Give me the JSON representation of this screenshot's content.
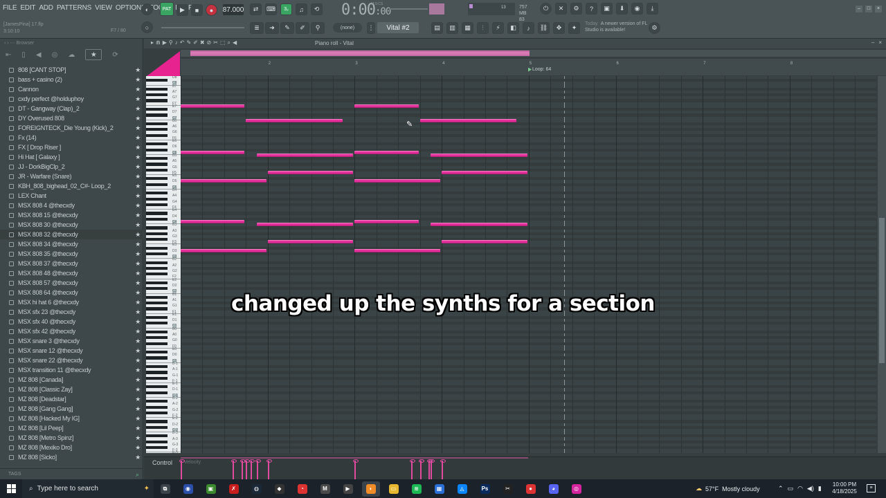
{
  "menu": [
    "FILE",
    "EDIT",
    "ADD",
    "PATTERNS",
    "VIEW",
    "OPTIONS",
    "TOOLS",
    "HELP"
  ],
  "project": {
    "name": "[JamesPina] 17.flp",
    "time": "3:10:10",
    "pattern_info": "F7 / 80"
  },
  "transport": {
    "pat_label": "PAT",
    "tempo": "87.000",
    "time": "0:00",
    "time_small": ":00",
    "time_unit": "M:S:CS",
    "ram": "757 MB",
    "cpu_count": "13",
    "cpu_val": "83"
  },
  "pattern_selector": {
    "value": "Vital #2",
    "none_value": "(none)"
  },
  "news": {
    "when": "Today",
    "text": "A newer version of FL Studio is available!"
  },
  "browser": {
    "title": "Browser",
    "items": [
      "808 [CANT STOP]",
      "bass + casino (2)",
      "Cannon",
      "cxdy perfect @holduphoy",
      "DT - Gangway (Clap)_2",
      "DY Overused 808",
      "FOREIGNTECK_Die Young (Kick)_2",
      "Fx (14)",
      "FX [ Drop Riser ]",
      "Hi Hat [ Galaxy ]",
      "JJ - DorkBigClp_2",
      "JR - Warfare (Snare)",
      "KBH_808_bighead_02_C#- Loop_2",
      "LEX Chant",
      "MSX 808 4 @thecxdy",
      "MSX 808 15 @thecxdy",
      "MSX 808 30 @thecxdy",
      "MSX 808 32 @thecxdy",
      "MSX 808 34 @thecxdy",
      "MSX 808 35 @thecxdy",
      "MSX 808 37 @thecxdy",
      "MSX 808 48 @thecxdy",
      "MSX 808 57 @thecxdy",
      "MSX 808 64 @thecxdy",
      "MSX hi hat 6 @thecxdy",
      "MSX sfx 23 @thecxdy",
      "MSX sfx 40 @thecxdy",
      "MSX sfx 42 @thecxdy",
      "MSX snare 3 @thecxdy",
      "MSX snare 12 @thecxdy",
      "MSX snare 22 @thecxdy",
      "MSX transition 11 @thecxdy",
      "MZ 808 [Canada]",
      "MZ 808 [Classic Zay]",
      "MZ 808 [Deadstar]",
      "MZ 808 [Gang Gang]",
      "MZ 808 [Hacked My IG]",
      "MZ 808 [Lil Peep]",
      "MZ 808 [Metro Spinz]",
      "MZ 808 [Mexiko Dro]",
      "MZ 808 [Sicko]"
    ],
    "star_glyph": "★",
    "tags_label": "TAGS"
  },
  "piano_roll": {
    "title": "Piano roll - Vital",
    "bars": [
      "2",
      "3",
      "4",
      "5",
      "6",
      "7",
      "8"
    ],
    "loop_label": "Loop: 64",
    "control_label": "Control",
    "control_sub": "Velocity",
    "notes": [
      {
        "key": "E7",
        "start": 1.0,
        "len": 0.75
      },
      {
        "key": "E7",
        "start": 3.0,
        "len": 0.75
      },
      {
        "key": "B6",
        "start": 1.75,
        "len": 1.125
      },
      {
        "key": "B6",
        "start": 3.75,
        "len": 1.125
      },
      {
        "key": "C6",
        "start": 1.0,
        "len": 0.75
      },
      {
        "key": "C6",
        "start": 3.0,
        "len": 0.75
      },
      {
        "key": "B5",
        "start": 1.875,
        "len": 1.125
      },
      {
        "key": "B5",
        "start": 3.875,
        "len": 1.125
      },
      {
        "key": "F5",
        "start": 2.0,
        "len": 1.0
      },
      {
        "key": "F5",
        "start": 4.0,
        "len": 1.0
      },
      {
        "key": "D5",
        "start": 1.0,
        "len": 1.0
      },
      {
        "key": "D5",
        "start": 3.0,
        "len": 1.0
      },
      {
        "key": "C4",
        "start": 1.0,
        "len": 0.75
      },
      {
        "key": "C4",
        "start": 3.0,
        "len": 0.75
      },
      {
        "key": "B3",
        "start": 1.875,
        "len": 1.125
      },
      {
        "key": "B3",
        "start": 3.875,
        "len": 1.125
      },
      {
        "key": "F3",
        "start": 2.0,
        "len": 1.0
      },
      {
        "key": "F3",
        "start": 4.0,
        "len": 1.0
      },
      {
        "key": "D3",
        "start": 1.0,
        "len": 1.0
      },
      {
        "key": "D3",
        "start": 3.0,
        "len": 1.0
      }
    ]
  },
  "caption": "changed up the synths for a section",
  "taskbar": {
    "search_placeholder": "Type here to search",
    "weather_temp": "57°F",
    "weather_text": "Mostly cloudy",
    "time": "10:00 PM",
    "date": "4/18/2025",
    "apps": [
      "task-view",
      "chrome-like",
      "minecraft",
      "adobe-x",
      "steam",
      "unity",
      "gauge",
      "mc",
      "play",
      "fl-studio",
      "files",
      "spotify",
      "photos",
      "azure",
      "photoshop",
      "capcut",
      "chrome",
      "discord",
      "instagram"
    ]
  },
  "colors": {
    "note": "#e0329a",
    "accent": "#e6238f",
    "bg": "#3a4345"
  }
}
